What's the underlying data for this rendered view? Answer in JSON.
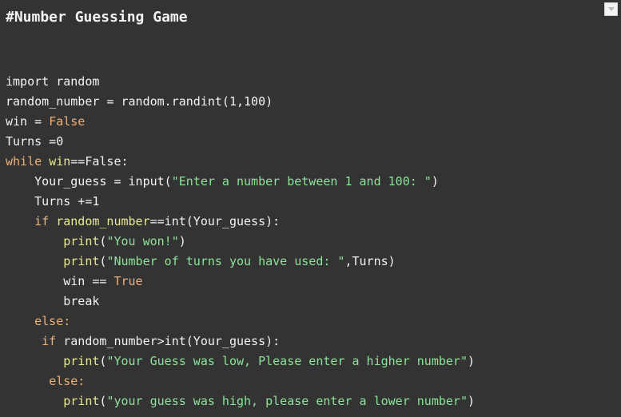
{
  "window": {
    "background_color": "#333333",
    "collapse_button": {
      "icon": "chevron-down-icon",
      "label": ""
    }
  },
  "title": "#Number Guessing Game",
  "editor": {
    "language": "python",
    "font": "monospace",
    "colors": {
      "background": "#333333",
      "default_text": "#f2f2f2",
      "keyword": "#ecb176",
      "constant": "#eeb07a",
      "function": "#eae98e",
      "variable": "#eae98e",
      "string": "#8ce399"
    },
    "code_text": "import random\nrandom_number = random.randint(1,100)\nwin = False\nTurns =0\nwhile win==False:\n    Your_guess = input(\"Enter a number between 1 and 100: \")\n    Turns +=1\n    if random_number==int(Your_guess):\n        print(\"You won!\")\n        print(\"Number of turns you have used: \",Turns)\n        win == True\n        break\n    else:\n     if random_number>int(Your_guess):\n        print(\"Your Guess was low, Please enter a higher number\")\n      else:\n        print(\"your guess was high, please enter a lower number\")",
    "lines": [
      {
        "n": 1,
        "tokens": [
          {
            "t": "import random",
            "c": "pl"
          }
        ]
      },
      {
        "n": 2,
        "tokens": [
          {
            "t": "random_number = random.randint(1,100)",
            "c": "pl"
          }
        ]
      },
      {
        "n": 3,
        "tokens": [
          {
            "t": "win = ",
            "c": "pl"
          },
          {
            "t": "False",
            "c": "cst"
          }
        ]
      },
      {
        "n": 4,
        "tokens": [
          {
            "t": "Turns =0",
            "c": "pl"
          }
        ]
      },
      {
        "n": 5,
        "tokens": [
          {
            "t": "while",
            "c": "kw"
          },
          {
            "t": " ",
            "c": "pl"
          },
          {
            "t": "win",
            "c": "var"
          },
          {
            "t": "==False:",
            "c": "pl"
          }
        ]
      },
      {
        "n": 6,
        "tokens": [
          {
            "t": "    Your_guess = input(",
            "c": "pl"
          },
          {
            "t": "\"Enter a number between 1 and 100: \"",
            "c": "str"
          },
          {
            "t": ")",
            "c": "pl"
          }
        ]
      },
      {
        "n": 7,
        "tokens": [
          {
            "t": "    Turns +=1",
            "c": "pl"
          }
        ]
      },
      {
        "n": 8,
        "tokens": [
          {
            "t": "    ",
            "c": "pl"
          },
          {
            "t": "if",
            "c": "kw"
          },
          {
            "t": " ",
            "c": "pl"
          },
          {
            "t": "random_number",
            "c": "var"
          },
          {
            "t": "==int(Your_guess):",
            "c": "pl"
          }
        ]
      },
      {
        "n": 9,
        "tokens": [
          {
            "t": "        ",
            "c": "pl"
          },
          {
            "t": "print",
            "c": "fn"
          },
          {
            "t": "(",
            "c": "pl"
          },
          {
            "t": "\"You won!\"",
            "c": "str"
          },
          {
            "t": ")",
            "c": "pl"
          }
        ]
      },
      {
        "n": 10,
        "tokens": [
          {
            "t": "        ",
            "c": "pl"
          },
          {
            "t": "print",
            "c": "fn"
          },
          {
            "t": "(",
            "c": "pl"
          },
          {
            "t": "\"Number of turns you have used: \"",
            "c": "str"
          },
          {
            "t": ",Turns)",
            "c": "pl"
          }
        ]
      },
      {
        "n": 11,
        "tokens": [
          {
            "t": "        win == ",
            "c": "pl"
          },
          {
            "t": "True",
            "c": "cst"
          }
        ]
      },
      {
        "n": 12,
        "tokens": [
          {
            "t": "        break",
            "c": "pl"
          }
        ]
      },
      {
        "n": 13,
        "tokens": [
          {
            "t": "    ",
            "c": "pl"
          },
          {
            "t": "else:",
            "c": "kw"
          }
        ]
      },
      {
        "n": 14,
        "tokens": [
          {
            "t": "     ",
            "c": "pl"
          },
          {
            "t": "if",
            "c": "kw"
          },
          {
            "t": " random_number>int(Your_guess):",
            "c": "pl"
          }
        ]
      },
      {
        "n": 15,
        "tokens": [
          {
            "t": "        ",
            "c": "pl"
          },
          {
            "t": "print",
            "c": "fn"
          },
          {
            "t": "(",
            "c": "pl"
          },
          {
            "t": "\"Your Guess was low, Please enter a higher number\"",
            "c": "str"
          },
          {
            "t": ")",
            "c": "pl"
          }
        ]
      },
      {
        "n": 16,
        "tokens": [
          {
            "t": "      ",
            "c": "pl"
          },
          {
            "t": "else:",
            "c": "kw"
          }
        ]
      },
      {
        "n": 17,
        "tokens": [
          {
            "t": "        ",
            "c": "pl"
          },
          {
            "t": "print",
            "c": "fn"
          },
          {
            "t": "(",
            "c": "pl"
          },
          {
            "t": "\"your guess was high, please enter a lower number\"",
            "c": "str"
          },
          {
            "t": ")",
            "c": "pl"
          }
        ]
      }
    ]
  }
}
